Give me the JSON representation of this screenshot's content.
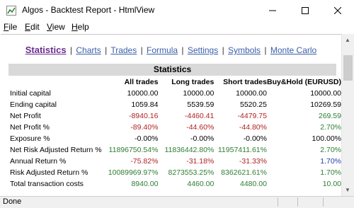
{
  "window": {
    "title": "Algos - Backtest Report - HtmlView"
  },
  "menu": {
    "items": [
      {
        "accel": "F",
        "rest": "ile"
      },
      {
        "accel": "E",
        "rest": "dit"
      },
      {
        "accel": "V",
        "rest": "iew"
      },
      {
        "accel": "H",
        "rest": "elp"
      }
    ]
  },
  "nav": {
    "links": [
      "Statistics",
      "Charts",
      "Trades",
      "Formula",
      "Settings",
      "Symbols",
      "Monte Carlo"
    ],
    "separator": "|"
  },
  "stats": {
    "title": "Statistics",
    "columns": [
      "",
      "All trades",
      "Long trades",
      "Short trades",
      "Buy&Hold (EURUSD)"
    ],
    "rows": [
      {
        "label": "Initial capital",
        "values": [
          "10000.00",
          "10000.00",
          "10000.00",
          "10000.00"
        ],
        "colors": [
          "",
          "",
          "",
          ""
        ]
      },
      {
        "label": "Ending capital",
        "values": [
          "1059.84",
          "5539.59",
          "5520.25",
          "10269.59"
        ],
        "colors": [
          "",
          "",
          "",
          ""
        ]
      },
      {
        "label": "Net Profit",
        "values": [
          "-8940.16",
          "-4460.41",
          "-4479.75",
          "269.59"
        ],
        "colors": [
          "red",
          "red",
          "red",
          "green"
        ]
      },
      {
        "label": "Net Profit %",
        "values": [
          "-89.40%",
          "-44.60%",
          "-44.80%",
          "2.70%"
        ],
        "colors": [
          "red",
          "red",
          "red",
          "green"
        ]
      },
      {
        "label": "Exposure %",
        "values": [
          "-0.00%",
          "-0.00%",
          "-0.00%",
          "100.00%"
        ],
        "colors": [
          "",
          "",
          "",
          ""
        ]
      },
      {
        "label": "Net Risk Adjusted Return %",
        "values": [
          "11896750.54%",
          "11836442.80%",
          "11957411.61%",
          "2.70%"
        ],
        "colors": [
          "green",
          "green",
          "green",
          "green"
        ]
      },
      {
        "label": "Annual Return %",
        "values": [
          "-75.82%",
          "-31.18%",
          "-31.33%",
          "1.70%"
        ],
        "colors": [
          "red",
          "red",
          "red",
          "blue"
        ]
      },
      {
        "label": "Risk Adjusted Return %",
        "values": [
          "10089969.97%",
          "8273553.25%",
          "8362621.61%",
          "1.70%"
        ],
        "colors": [
          "green",
          "green",
          "green",
          "green"
        ]
      },
      {
        "label": "Total transaction costs",
        "values": [
          "8940.00",
          "4460.00",
          "4480.00",
          "10.00"
        ],
        "colors": [
          "green",
          "green",
          "green",
          "green"
        ]
      }
    ]
  },
  "status": {
    "text": "Done"
  },
  "colors": {
    "active_link": "#6a2c8f",
    "link": "#3a5fa8",
    "negative": "#b22222",
    "positive": "#2e7d32",
    "annual_bh": "#1f3fae"
  }
}
